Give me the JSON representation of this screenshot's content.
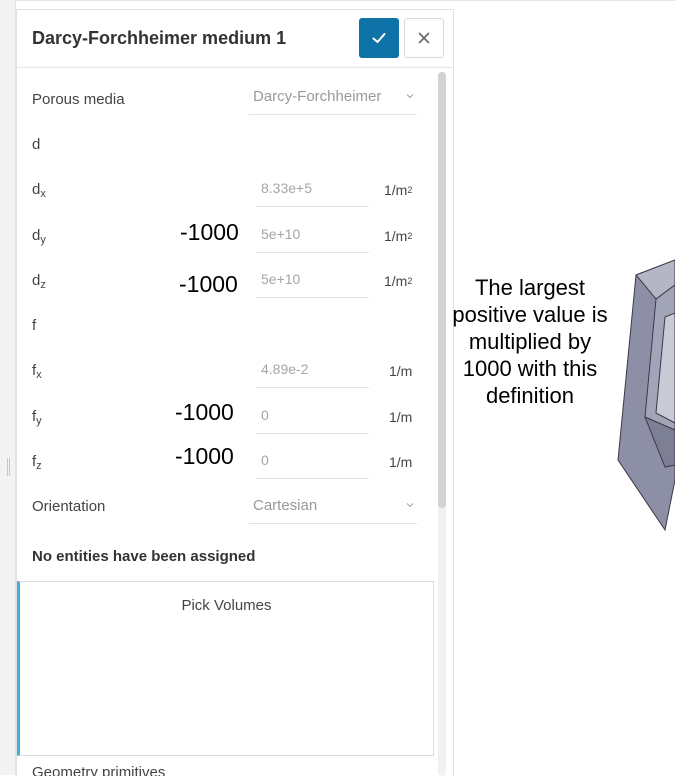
{
  "panel": {
    "title": "Darcy-Forchheimer medium 1",
    "confirm_icon": "check-icon",
    "close_icon": "close-icon"
  },
  "porous_media": {
    "label": "Porous media",
    "value": "Darcy-Forchheimer"
  },
  "d": {
    "section_label": "d",
    "rows": [
      {
        "base": "d",
        "sub": "x",
        "value": "8.33e+5",
        "unit_base": "1/m",
        "unit_sup": "2",
        "overlay": ""
      },
      {
        "base": "d",
        "sub": "y",
        "value": "5e+10",
        "unit_base": "1/m",
        "unit_sup": "2",
        "overlay": "-1000"
      },
      {
        "base": "d",
        "sub": "z",
        "value": "5e+10",
        "unit_base": "1/m",
        "unit_sup": "2",
        "overlay": "-1000"
      }
    ]
  },
  "f": {
    "section_label": "f",
    "rows": [
      {
        "base": "f",
        "sub": "x",
        "value": "4.89e-2",
        "unit": "1/m",
        "overlay": ""
      },
      {
        "base": "f",
        "sub": "y",
        "value": "0",
        "unit": "1/m",
        "overlay": "-1000"
      },
      {
        "base": "f",
        "sub": "z",
        "value": "0",
        "unit": "1/m",
        "overlay": "-1000"
      }
    ]
  },
  "orientation": {
    "label": "Orientation",
    "value": "Cartesian"
  },
  "assignment": {
    "warning": "No entities have been assigned",
    "pick_label": "Pick Volumes",
    "next_section_label": "Geometry primitives"
  },
  "annotation": {
    "lines": [
      "The largest",
      "positive value is",
      "multiplied by",
      "1000 with this",
      "definition"
    ]
  },
  "colors": {
    "accent": "#0f72a6",
    "pick_highlight": "#3fb1d6",
    "shape_fill": "#8d8fa6"
  }
}
